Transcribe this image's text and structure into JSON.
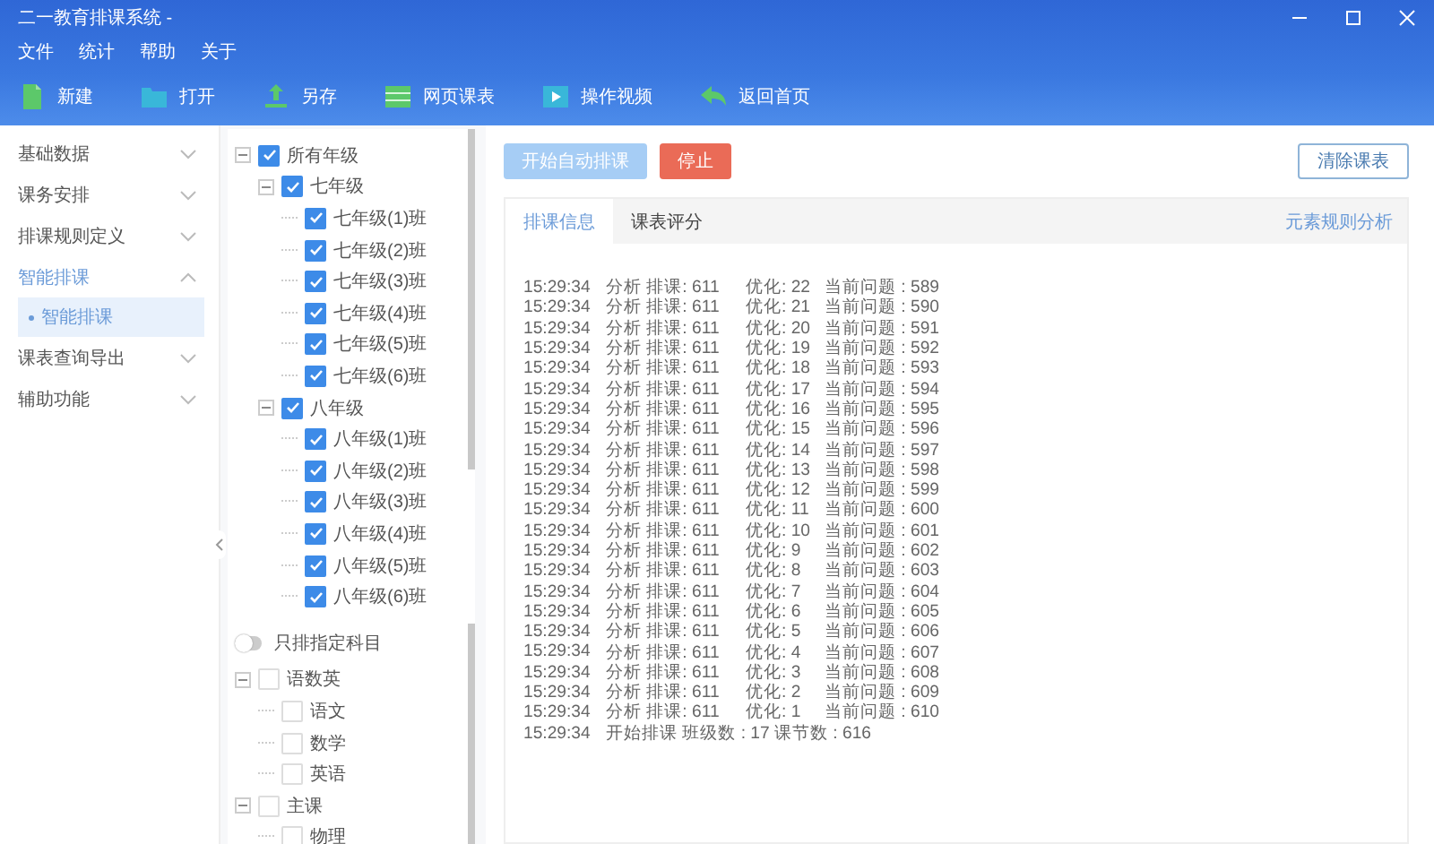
{
  "window": {
    "title": "二一教育排课系统 -"
  },
  "menu": [
    "文件",
    "统计",
    "帮助",
    "关于"
  ],
  "toolbar": [
    "新建",
    "打开",
    "另存",
    "网页课表",
    "操作视频",
    "返回首页"
  ],
  "sidebar": {
    "items": [
      {
        "label": "基础数据",
        "expanded": false,
        "selected": false
      },
      {
        "label": "课务安排",
        "expanded": false,
        "selected": false
      },
      {
        "label": "排课规则定义",
        "expanded": false,
        "selected": false
      },
      {
        "label": "智能排课",
        "expanded": true,
        "selected": true,
        "children": [
          {
            "label": "智能排课",
            "selected": true
          }
        ]
      },
      {
        "label": "课表查询导出",
        "expanded": false,
        "selected": false
      },
      {
        "label": "辅助功能",
        "expanded": false,
        "selected": false
      }
    ]
  },
  "class_tree": {
    "items": [
      {
        "label": "所有年级",
        "checked": true,
        "expanded": true,
        "children": [
          {
            "label": "七年级",
            "checked": true,
            "expanded": true,
            "children": [
              {
                "label": "七年级(1)班",
                "checked": true
              },
              {
                "label": "七年级(2)班",
                "checked": true
              },
              {
                "label": "七年级(3)班",
                "checked": true
              },
              {
                "label": "七年级(4)班",
                "checked": true
              },
              {
                "label": "七年级(5)班",
                "checked": true
              },
              {
                "label": "七年级(6)班",
                "checked": true
              }
            ]
          },
          {
            "label": "八年级",
            "checked": true,
            "expanded": true,
            "children": [
              {
                "label": "八年级(1)班",
                "checked": true
              },
              {
                "label": "八年级(2)班",
                "checked": true
              },
              {
                "label": "八年级(3)班",
                "checked": true
              },
              {
                "label": "八年级(4)班",
                "checked": true
              },
              {
                "label": "八年级(5)班",
                "checked": true
              },
              {
                "label": "八年级(6)班",
                "checked": true
              }
            ]
          }
        ]
      }
    ]
  },
  "subject_toggle": {
    "label": "只排指定科目",
    "on": false
  },
  "subject_tree": {
    "items": [
      {
        "label": "语数英",
        "checked": false,
        "expanded": true,
        "children": [
          {
            "label": "语文",
            "checked": false
          },
          {
            "label": "数学",
            "checked": false
          },
          {
            "label": "英语",
            "checked": false
          }
        ]
      },
      {
        "label": "主课",
        "checked": false,
        "expanded": true,
        "children": [
          {
            "label": "物理",
            "checked": false
          }
        ]
      }
    ]
  },
  "actions": [
    {
      "label": "开始自动排课",
      "kind": "primary",
      "disabled": true
    },
    {
      "label": "停止",
      "kind": "danger",
      "disabled": false
    }
  ],
  "clear_button": {
    "label": "清除课表"
  },
  "tabs": [
    {
      "label": "排课信息",
      "selected": true
    },
    {
      "label": "课表评分",
      "selected": false
    }
  ],
  "tab_link": "元素规则分析",
  "log": [
    {
      "time": "15:29:34",
      "columns": [
        "分析 排课: 611",
        "优化: 22",
        "当前问题 : 589"
      ]
    },
    {
      "time": "15:29:34",
      "columns": [
        "分析 排课: 611",
        "优化: 21",
        "当前问题 : 590"
      ]
    },
    {
      "time": "15:29:34",
      "columns": [
        "分析 排课: 611",
        "优化: 20",
        "当前问题 : 591"
      ]
    },
    {
      "time": "15:29:34",
      "columns": [
        "分析 排课: 611",
        "优化: 19",
        "当前问题 : 592"
      ]
    },
    {
      "time": "15:29:34",
      "columns": [
        "分析 排课: 611",
        "优化: 18",
        "当前问题 : 593"
      ]
    },
    {
      "time": "15:29:34",
      "columns": [
        "分析 排课: 611",
        "优化: 17",
        "当前问题 : 594"
      ]
    },
    {
      "time": "15:29:34",
      "columns": [
        "分析 排课: 611",
        "优化: 16",
        "当前问题 : 595"
      ]
    },
    {
      "time": "15:29:34",
      "columns": [
        "分析 排课: 611",
        "优化: 15",
        "当前问题 : 596"
      ]
    },
    {
      "time": "15:29:34",
      "columns": [
        "分析 排课: 611",
        "优化: 14",
        "当前问题 : 597"
      ]
    },
    {
      "time": "15:29:34",
      "columns": [
        "分析 排课: 611",
        "优化: 13",
        "当前问题 : 598"
      ]
    },
    {
      "time": "15:29:34",
      "columns": [
        "分析 排课: 611",
        "优化: 12",
        "当前问题 : 599"
      ]
    },
    {
      "time": "15:29:34",
      "columns": [
        "分析 排课: 611",
        "优化: 11",
        "当前问题 : 600"
      ]
    },
    {
      "time": "15:29:34",
      "columns": [
        "分析 排课: 611",
        "优化: 10",
        "当前问题 : 601"
      ]
    },
    {
      "time": "15:29:34",
      "columns": [
        "分析 排课: 611",
        "优化: 9",
        "当前问题 : 602"
      ]
    },
    {
      "time": "15:29:34",
      "columns": [
        "分析 排课: 611",
        "优化: 8",
        "当前问题 : 603"
      ]
    },
    {
      "time": "15:29:34",
      "columns": [
        "分析 排课: 611",
        "优化: 7",
        "当前问题 : 604"
      ]
    },
    {
      "time": "15:29:34",
      "columns": [
        "分析 排课: 611",
        "优化: 6",
        "当前问题 : 605"
      ]
    },
    {
      "time": "15:29:34",
      "columns": [
        "分析 排课: 611",
        "优化: 5",
        "当前问题 : 606"
      ]
    },
    {
      "time": "15:29:34",
      "columns": [
        "分析 排课: 611",
        "优化: 4",
        "当前问题 : 607"
      ]
    },
    {
      "time": "15:29:34",
      "columns": [
        "分析 排课: 611",
        "优化: 3",
        "当前问题 : 608"
      ]
    },
    {
      "time": "15:29:34",
      "columns": [
        "分析 排课: 611",
        "优化: 2",
        "当前问题 : 609"
      ]
    },
    {
      "time": "15:29:34",
      "columns": [
        "分析 排课: 611",
        "优化: 1",
        "当前问题 : 610"
      ]
    },
    {
      "time": "15:29:34",
      "columns": [
        "开始排课 班级数 : 17 课节数 : 616"
      ]
    }
  ]
}
